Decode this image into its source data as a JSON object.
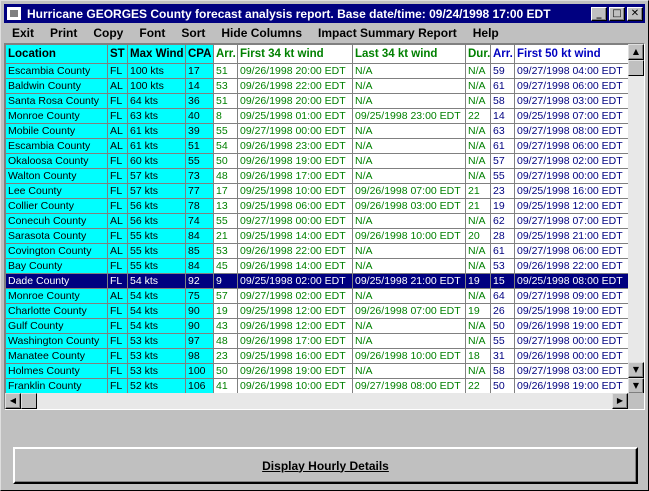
{
  "window": {
    "title": "Hurricane GEORGES County  forecast analysis report.  Base date/time: 09/24/1998 17:00 EDT",
    "controls": {
      "minimize": "_",
      "maximize": "□",
      "close": "✕"
    }
  },
  "menu": [
    "Exit",
    "Print",
    "Copy",
    "Font",
    "Sort",
    "Hide Columns",
    "Impact Summary Report",
    "Help"
  ],
  "columns": [
    "Location",
    "ST",
    "Max Wind",
    "CPA",
    "Arr.",
    "First 34 kt wind",
    "Last 34 kt wind",
    "Dur.",
    "Arr.",
    "First 50 kt wind"
  ],
  "rows": [
    [
      "Escambia County",
      "FL",
      "100 kts",
      "17",
      "51",
      "09/26/1998 20:00 EDT",
      "N/A",
      "N/A",
      "59",
      "09/27/1998 04:00 EDT"
    ],
    [
      "Baldwin County",
      "AL",
      "100 kts",
      "14",
      "53",
      "09/26/1998 22:00 EDT",
      "N/A",
      "N/A",
      "61",
      "09/27/1998 06:00 EDT"
    ],
    [
      "Santa Rosa County",
      "FL",
      "64 kts",
      "36",
      "51",
      "09/26/1998 20:00 EDT",
      "N/A",
      "N/A",
      "58",
      "09/27/1998 03:00 EDT"
    ],
    [
      "Monroe County",
      "FL",
      "63 kts",
      "40",
      "8",
      "09/25/1998 01:00 EDT",
      "09/25/1998 23:00 EDT",
      "22",
      "14",
      "09/25/1998 07:00 EDT"
    ],
    [
      "Mobile County",
      "AL",
      "61 kts",
      "39",
      "55",
      "09/27/1998 00:00 EDT",
      "N/A",
      "N/A",
      "63",
      "09/27/1998 08:00 EDT"
    ],
    [
      "Escambia County",
      "AL",
      "61 kts",
      "51",
      "54",
      "09/26/1998 23:00 EDT",
      "N/A",
      "N/A",
      "61",
      "09/27/1998 06:00 EDT"
    ],
    [
      "Okaloosa County",
      "FL",
      "60 kts",
      "55",
      "50",
      "09/26/1998 19:00 EDT",
      "N/A",
      "N/A",
      "57",
      "09/27/1998 02:00 EDT"
    ],
    [
      "Walton County",
      "FL",
      "57 kts",
      "73",
      "48",
      "09/26/1998 17:00 EDT",
      "N/A",
      "N/A",
      "55",
      "09/27/1998 00:00 EDT"
    ],
    [
      "Lee County",
      "FL",
      "57 kts",
      "77",
      "17",
      "09/25/1998 10:00 EDT",
      "09/26/1998 07:00 EDT",
      "21",
      "23",
      "09/25/1998 16:00 EDT"
    ],
    [
      "Collier County",
      "FL",
      "56 kts",
      "78",
      "13",
      "09/25/1998 06:00 EDT",
      "09/26/1998 03:00 EDT",
      "21",
      "19",
      "09/25/1998 12:00 EDT"
    ],
    [
      "Conecuh County",
      "AL",
      "56 kts",
      "74",
      "55",
      "09/27/1998 00:00 EDT",
      "N/A",
      "N/A",
      "62",
      "09/27/1998 07:00 EDT"
    ],
    [
      "Sarasota County",
      "FL",
      "55 kts",
      "84",
      "21",
      "09/25/1998 14:00 EDT",
      "09/26/1998 10:00 EDT",
      "20",
      "28",
      "09/25/1998 21:00 EDT"
    ],
    [
      "Covington County",
      "AL",
      "55 kts",
      "85",
      "53",
      "09/26/1998 22:00 EDT",
      "N/A",
      "N/A",
      "61",
      "09/27/1998 06:00 EDT"
    ],
    [
      "Bay County",
      "FL",
      "55 kts",
      "84",
      "45",
      "09/26/1998 14:00 EDT",
      "N/A",
      "N/A",
      "53",
      "09/26/1998 22:00 EDT"
    ],
    [
      "Dade County",
      "FL",
      "54 kts",
      "92",
      "9",
      "09/25/1998 02:00 EDT",
      "09/25/1998 21:00 EDT",
      "19",
      "15",
      "09/25/1998 08:00 EDT"
    ],
    [
      "Monroe County",
      "AL",
      "54 kts",
      "75",
      "57",
      "09/27/1998 02:00 EDT",
      "N/A",
      "N/A",
      "64",
      "09/27/1998 09:00 EDT"
    ],
    [
      "Charlotte County",
      "FL",
      "54 kts",
      "90",
      "19",
      "09/25/1998 12:00 EDT",
      "09/26/1998 07:00 EDT",
      "19",
      "26",
      "09/25/1998 19:00 EDT"
    ],
    [
      "Gulf County",
      "FL",
      "54 kts",
      "90",
      "43",
      "09/26/1998 12:00 EDT",
      "N/A",
      "N/A",
      "50",
      "09/26/1998 19:00 EDT"
    ],
    [
      "Washington County",
      "FL",
      "53 kts",
      "97",
      "48",
      "09/26/1998 17:00 EDT",
      "N/A",
      "N/A",
      "55",
      "09/27/1998 00:00 EDT"
    ],
    [
      "Manatee County",
      "FL",
      "53 kts",
      "98",
      "23",
      "09/25/1998 16:00 EDT",
      "09/26/1998 10:00 EDT",
      "18",
      "31",
      "09/26/1998 00:00 EDT"
    ],
    [
      "Holmes County",
      "FL",
      "53 kts",
      "100",
      "50",
      "09/26/1998 19:00 EDT",
      "N/A",
      "N/A",
      "58",
      "09/27/1998 03:00 EDT"
    ],
    [
      "Franklin County",
      "FL",
      "52 kts",
      "106",
      "41",
      "09/26/1998 10:00 EDT",
      "09/27/1998 08:00 EDT",
      "22",
      "50",
      "09/26/1998 19:00 EDT"
    ]
  ],
  "selected_row": 14,
  "scroll": {
    "up": "▲",
    "down": "▼",
    "left": "◀",
    "right": "▶"
  },
  "detail_button": "Display Hourly Details",
  "colors": {
    "title_bar": "#000080",
    "cyan": "#00ffff",
    "green": "#008000",
    "blue": "#0000c0",
    "selection": "#000080"
  }
}
